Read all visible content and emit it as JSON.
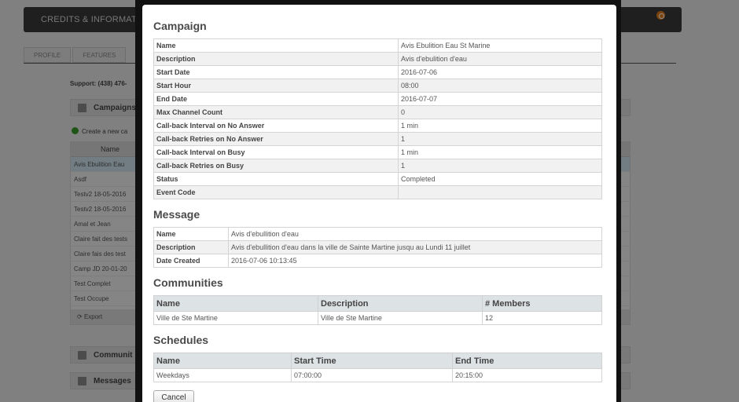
{
  "background": {
    "header_title": "CREDITS & INFORMATIC",
    "tabs": [
      "PROFILE",
      "FEATURES"
    ],
    "support": "Support: (438) 476-",
    "campaigns_label": "Campaigns",
    "create_label": "Create a new ca",
    "grid_header": "Name",
    "rows": [
      "Avis Ebulition Eau",
      "Asdf",
      "Testv2 18-05-2016",
      "Testv2 18-05-2016",
      "Amal et Jean",
      "Claire fait des tests",
      "Claire fais des test",
      "Camp JD 20-01-20",
      "Test Complet",
      "Test Occupe"
    ],
    "export_label": "Export",
    "communities_label": "Communit",
    "messages_label": "Messages"
  },
  "modal": {
    "campaign": {
      "title": "Campaign",
      "fields": [
        {
          "key": "Name",
          "value": "Avis Ebulition Eau St Marine"
        },
        {
          "key": "Description",
          "value": "Avis d'ebulition d'eau"
        },
        {
          "key": "Start Date",
          "value": "2016-07-06"
        },
        {
          "key": "Start Hour",
          "value": "08:00"
        },
        {
          "key": "End Date",
          "value": "2016-07-07"
        },
        {
          "key": "Max Channel Count",
          "value": "0"
        },
        {
          "key": "Call-back Interval on No Answer",
          "value": "1 min"
        },
        {
          "key": "Call-back Retries on No Answer",
          "value": "1"
        },
        {
          "key": "Call-back Interval on Busy",
          "value": "1 min"
        },
        {
          "key": "Call-back Retries on Busy",
          "value": "1"
        },
        {
          "key": "Status",
          "value": "Completed"
        },
        {
          "key": "Event Code",
          "value": ""
        }
      ]
    },
    "message": {
      "title": "Message",
      "fields": [
        {
          "key": "Name",
          "value": "Avis d'ebullition d'eau"
        },
        {
          "key": "Description",
          "value": "Avis d'ebullition d'eau dans la ville de Sainte Martine jusqu au Lundi 11 juillet"
        },
        {
          "key": "Date Created",
          "value": "2016-07-06 10:13:45"
        }
      ]
    },
    "communities": {
      "title": "Communities",
      "headers": [
        "Name",
        "Description",
        "# Members"
      ],
      "rows": [
        [
          "Ville de Ste Martine",
          "Ville de Ste Martine",
          "12"
        ]
      ]
    },
    "schedules": {
      "title": "Schedules",
      "headers": [
        "Name",
        "Start Time",
        "End Time"
      ],
      "rows": [
        [
          "Weekdays",
          "07:00:00",
          "20:15:00"
        ]
      ]
    },
    "cancel_label": "Cancel"
  }
}
